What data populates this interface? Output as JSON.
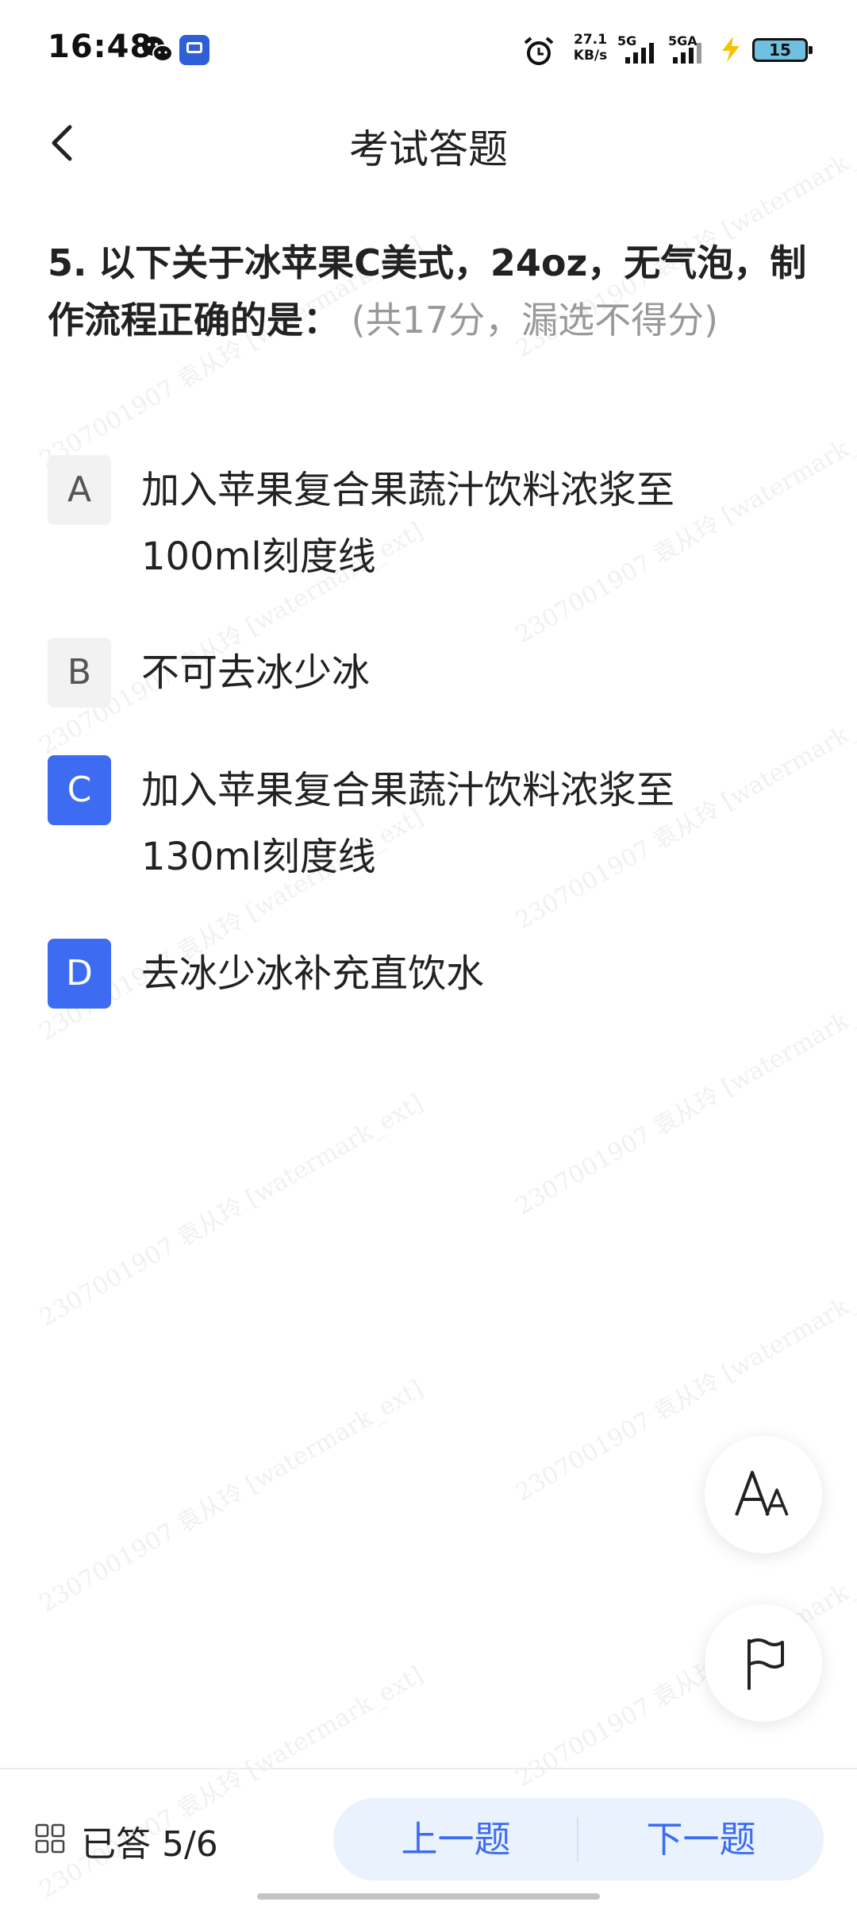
{
  "status_bar": {
    "time": "16:48",
    "net_speed_value": "27.1",
    "net_speed_unit": "KB/s",
    "sim1_label": "5G",
    "sim2_label": "5GA",
    "battery_level": "15",
    "icons": [
      "wechat-icon",
      "app-icon",
      "alarm-icon",
      "signal-icon",
      "charging-bolt-icon",
      "battery-icon"
    ]
  },
  "header": {
    "title": "考试答题",
    "back_icon": "chevron-left-icon"
  },
  "question": {
    "number": "5.",
    "text": "以下关于冰苹果C美式，24oz，无气泡，制作流程正确的是：",
    "score_note": "(共17分，漏选不得分)"
  },
  "options": [
    {
      "letter": "A",
      "text": "加入苹果复合果蔬汁饮料浓浆至100ml刻度线",
      "selected": false
    },
    {
      "letter": "B",
      "text": "不可去冰少冰",
      "selected": false
    },
    {
      "letter": "C",
      "text": "加入苹果复合果蔬汁饮料浓浆至130ml刻度线",
      "selected": true
    },
    {
      "letter": "D",
      "text": "去冰少冰补充直饮水",
      "selected": true
    }
  ],
  "floating_buttons": [
    "font-size-icon",
    "flag-icon"
  ],
  "bottom_bar": {
    "answered_text": "已答 5/6",
    "prev_label": "上一题",
    "next_label": "下一题"
  },
  "watermark": {
    "text": "2307001907 袁从玲 [watermark_ext]"
  },
  "colors": {
    "accent": "#3d6cf2",
    "nav_background": "#eaf2fd",
    "option_unselected_bg": "#f2f2f2",
    "score_gray": "#999999"
  }
}
